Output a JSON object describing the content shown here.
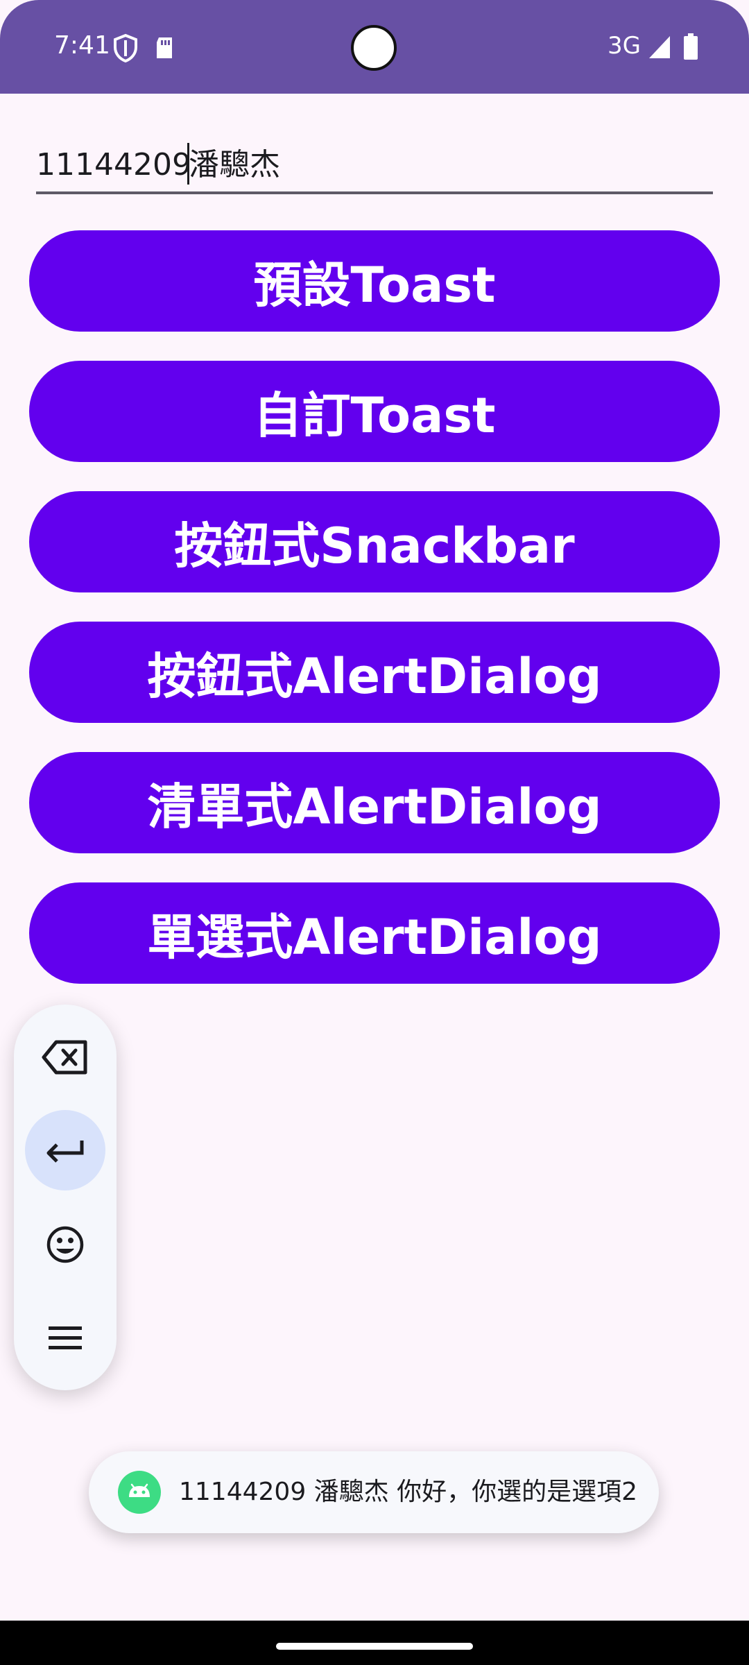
{
  "status_bar": {
    "time": "7:41",
    "network": "3G"
  },
  "text_input": {
    "prefix": "11144209",
    "suffix": "潘驄杰"
  },
  "buttons": [
    {
      "label": "預設Toast"
    },
    {
      "label": "自訂Toast"
    },
    {
      "label": "按鈕式Snackbar"
    },
    {
      "label": "按鈕式AlertDialog"
    },
    {
      "label": "清單式AlertDialog"
    },
    {
      "label": "單選式AlertDialog"
    }
  ],
  "keyboard_toolbar": {
    "icons": [
      "backspace-icon",
      "enter-icon",
      "emoji-icon",
      "menu-icon"
    ]
  },
  "toast": {
    "message": "11144209 潘驄杰 你好，你選的是選項2",
    "icon": "android-icon"
  },
  "colors": {
    "status_bar": "#6750A4",
    "background": "#FDF5FC",
    "button": "#6200EE",
    "toast_icon": "#3DDC84"
  }
}
